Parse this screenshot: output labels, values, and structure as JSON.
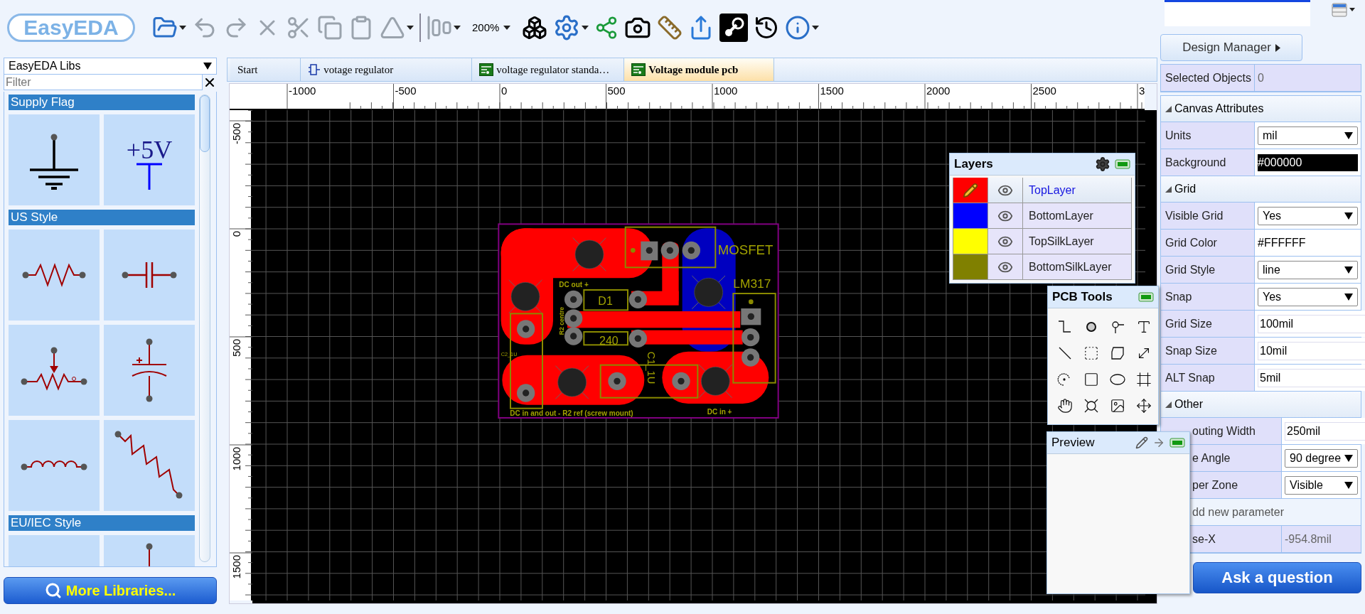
{
  "toolbar": {
    "logo": "EasyEDA",
    "zoom": "200%"
  },
  "library": {
    "source": "EasyEDA Libs",
    "filter_placeholder": "Filter",
    "sections": [
      {
        "title": "Supply Flag",
        "symbols": [
          {
            "kind": "ground"
          },
          {
            "kind": "power",
            "label": "+5V"
          }
        ]
      },
      {
        "title": "US Style",
        "symbols": [
          {
            "kind": "resistor"
          },
          {
            "kind": "capacitor"
          },
          {
            "kind": "potentiometer"
          },
          {
            "kind": "polarized-capacitor"
          },
          {
            "kind": "inductor"
          },
          {
            "kind": "resistor-diagonal"
          }
        ]
      },
      {
        "title": "EU/IEC Style",
        "symbols": [
          {
            "kind": "blank"
          },
          {
            "kind": "wire"
          }
        ]
      }
    ],
    "more_button": "More Libraries..."
  },
  "tabs": [
    {
      "label": "Start",
      "kind": "plain",
      "selected": false
    },
    {
      "label": "votage regulator",
      "kind": "schematic",
      "selected": false
    },
    {
      "label": "voltage regulator standa…",
      "kind": "pcb",
      "selected": false
    },
    {
      "label": "Voltage module pcb",
      "kind": "pcb",
      "selected": true
    }
  ],
  "ruler": {
    "x_labels": [
      "-1000",
      "-500",
      "0",
      "500",
      "1000",
      "1500",
      "2000",
      "2500",
      "3"
    ],
    "y_labels": [
      "-500",
      "0",
      "500",
      "1000",
      "1500"
    ]
  },
  "pcb": {
    "silk_labels": [
      "MOSFET",
      "DC out +",
      "LM317",
      "R2 centre",
      "D1",
      "240",
      "C1_1U",
      "C2_1U",
      "DC in and out - R2 ref (screw mount)",
      "DC in +"
    ]
  },
  "layers": {
    "title": "Layers",
    "rows": [
      {
        "name": "TopLayer",
        "color": "#ff0000",
        "selected": true
      },
      {
        "name": "BottomLayer",
        "color": "#0000ff",
        "selected": false
      },
      {
        "name": "TopSilkLayer",
        "color": "#ffff00",
        "selected": false
      },
      {
        "name": "BottomSilkLayer",
        "color": "#808000",
        "selected": false
      }
    ]
  },
  "pcb_tools": {
    "title": "PCB Tools"
  },
  "preview": {
    "title": "Preview"
  },
  "design_manager": "Design Manager",
  "selected_objects": {
    "label": "Selected Objects",
    "value": "0"
  },
  "property_sections": [
    {
      "title": "Canvas Attributes",
      "rows": [
        {
          "kind": "select",
          "label": "Units",
          "value": "mil"
        },
        {
          "kind": "color",
          "label": "Background",
          "value": "#000000"
        }
      ]
    },
    {
      "title": "Grid",
      "rows": [
        {
          "kind": "select",
          "label": "Visible Grid",
          "value": "Yes"
        },
        {
          "kind": "text",
          "label": "Grid Color",
          "value": "#FFFFFF"
        },
        {
          "kind": "select",
          "label": "Grid Style",
          "value": "line"
        },
        {
          "kind": "select",
          "label": "Snap",
          "value": "Yes"
        },
        {
          "kind": "input",
          "label": "Grid Size",
          "value": "100mil"
        },
        {
          "kind": "input",
          "label": "Snap Size",
          "value": "10mil"
        },
        {
          "kind": "input",
          "label": "ALT Snap",
          "value": "5mil"
        }
      ]
    },
    {
      "title": "Other",
      "rows": [
        {
          "kind": "input",
          "label": "outing Width",
          "value": "250mil"
        },
        {
          "kind": "select",
          "label": "e Angle",
          "value": "90 degree"
        },
        {
          "kind": "select",
          "label": "per Zone",
          "value": "Visible"
        },
        {
          "kind": "link",
          "label": "dd new parameter"
        },
        {
          "kind": "readout",
          "label": "se-X",
          "value": "-954.8mil"
        }
      ]
    }
  ],
  "ask_button": "Ask a question"
}
